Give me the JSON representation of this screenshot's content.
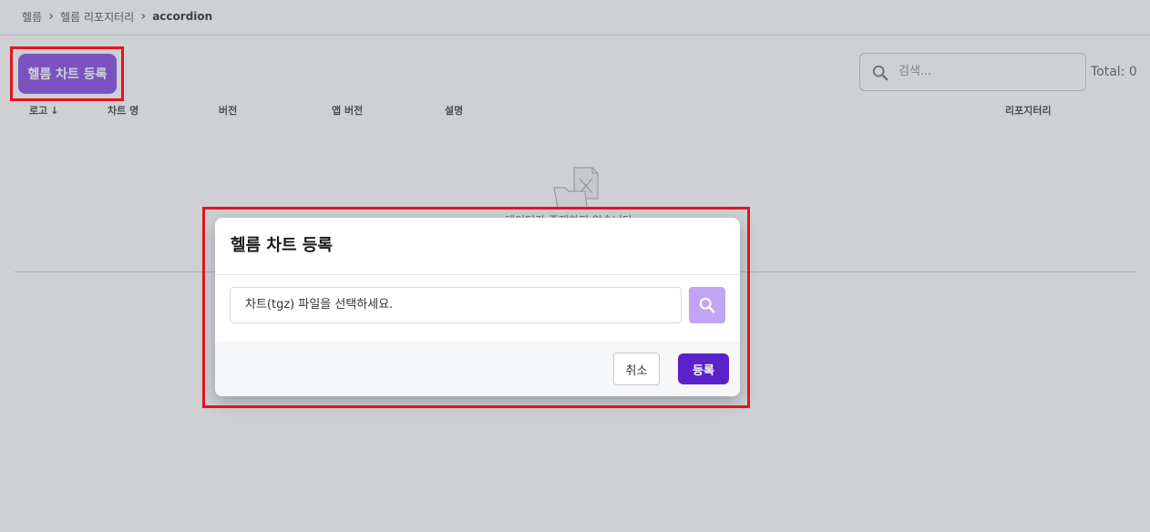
{
  "breadcrumb": {
    "items": [
      "헬름",
      "헬름 리포지터리",
      "accordion"
    ],
    "separator": "›"
  },
  "toolbar": {
    "register_label": "헬름 차트 등록",
    "search_placeholder": "검색...",
    "search_icon": "search-icon",
    "total_label": "Total: 0"
  },
  "table": {
    "columns": [
      "로고",
      "차트 명",
      "버전",
      "앱 버전",
      "설명",
      "리포지터리"
    ],
    "sort_icon": "↓",
    "empty_icon": "empty-folder-icon",
    "empty_text": "데이터가 존재하지 않습니다"
  },
  "modal": {
    "title": "헬름 차트 등록",
    "file_placeholder": "차트(tgz) 파일을 선택하세요.",
    "file_search_icon": "search-icon",
    "cancel_label": "취소",
    "confirm_label": "등록"
  },
  "colors": {
    "accent": "#7d3ce0",
    "confirm": "#5b22c9",
    "search_button": "#c2a4f5",
    "annotation": "#e4141c"
  }
}
